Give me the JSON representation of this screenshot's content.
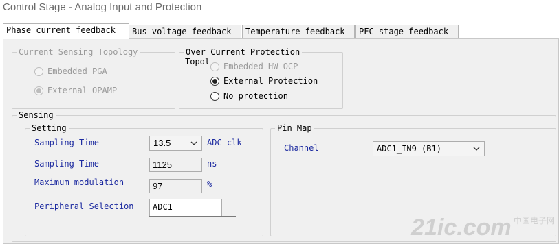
{
  "window": {
    "title": "Control Stage - Analog Input and Protection"
  },
  "tabs": [
    {
      "label": "Phase current feedback",
      "active": true
    },
    {
      "label": "Bus voltage feedback",
      "active": false
    },
    {
      "label": "Temperature feedback",
      "active": false
    },
    {
      "label": "PFC stage feedback",
      "active": false
    }
  ],
  "topology": {
    "legend": "Current Sensing Topology",
    "enabled": false,
    "options": [
      {
        "label": "Embedded PGA",
        "selected": false
      },
      {
        "label": "External OPAMP",
        "selected": true
      }
    ]
  },
  "ocp": {
    "legend_line1": "Over Current Protection",
    "legend_line2": "Topol",
    "options": [
      {
        "label": "Embedded HW OCP",
        "selected": false,
        "enabled": false
      },
      {
        "label": "External Protection",
        "selected": true,
        "enabled": true
      },
      {
        "label": "No protection",
        "selected": false,
        "enabled": true
      }
    ]
  },
  "sensing": {
    "legend": "Sensing",
    "setting": {
      "legend": "Setting",
      "rows": [
        {
          "label": "Sampling Time",
          "value": "13.5",
          "unit": "ADC clk",
          "kind": "select"
        },
        {
          "label": "Sampling Time",
          "value": "1125",
          "unit": "ns",
          "kind": "readonly"
        },
        {
          "label": "Maximum modulation",
          "value": "97",
          "unit": "%",
          "kind": "readonly"
        },
        {
          "label": "Peripheral Selection",
          "value": "ADC1",
          "unit": "",
          "kind": "input"
        }
      ]
    },
    "pinmap": {
      "legend": "Pin Map",
      "channel_label": "Channel",
      "channel_value": "ADC1_IN9 (B1)"
    }
  },
  "watermark": {
    "text": "21ic.com",
    "cn": "中国电子网"
  },
  "colors": {
    "label_blue": "#1c2aa0",
    "panel_bg": "#f0f0f0",
    "disabled_text": "#9a9a9a"
  },
  "icons": {
    "dropdown": "chevron-down-icon",
    "radio": "radio-icon"
  }
}
